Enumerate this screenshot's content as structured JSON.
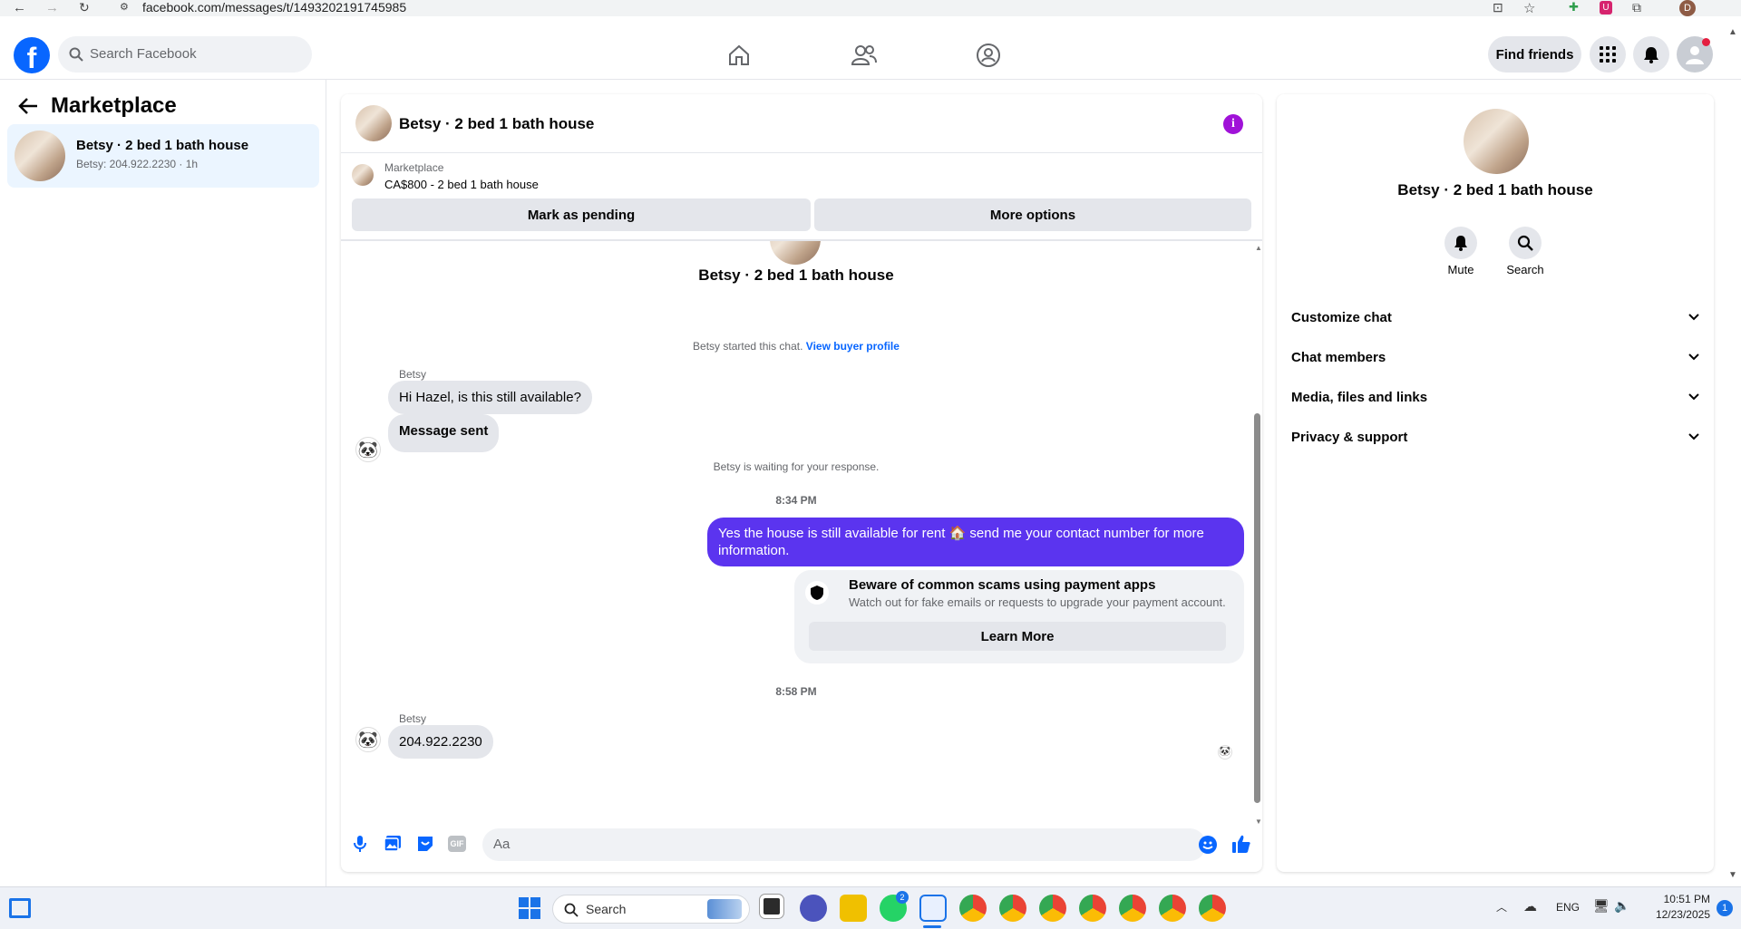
{
  "browser": {
    "url": "facebook.com/messages/t/1493202191745985",
    "avatar_letter": "D"
  },
  "header": {
    "search_placeholder": "Search Facebook",
    "find_friends": "Find friends"
  },
  "sidebar": {
    "title": "Marketplace",
    "conversations": [
      {
        "title": "Betsy · 2 bed 1 bath house",
        "subtitle": "Betsy: 204.922.2230 · 1h"
      }
    ]
  },
  "chat": {
    "title": "Betsy · 2 bed 1 bath house",
    "listing": {
      "label": "Marketplace",
      "price_title": "CA$800 - 2 bed 1 bath house",
      "mark_pending": "Mark as pending",
      "more_options": "More options"
    },
    "profile_name": "Betsy · 2 bed 1 bath house",
    "started_text": "Betsy started this chat.",
    "view_buyer_profile": "View buyer profile",
    "messages_group1": {
      "sender": "Betsy",
      "messages": [
        "Hi Hazel, is this still available?",
        "Message sent"
      ]
    },
    "waiting_text": "Betsy is waiting for your response.",
    "time1": "8:34 PM",
    "outgoing": "Yes the house is still available for rent 🏠 send me your contact number for more information.",
    "scam": {
      "title": "Beware of common scams using payment apps",
      "body": "Watch out for fake emails or requests to upgrade your payment account.",
      "learn_more": "Learn More"
    },
    "time2": "8:58 PM",
    "messages_group2": {
      "sender": "Betsy",
      "messages": [
        "204.922.2230"
      ]
    },
    "composer_placeholder": "Aa",
    "accent": "#5b34ef"
  },
  "details": {
    "name": "Betsy · 2 bed 1 bath house",
    "mute": "Mute",
    "search": "Search",
    "sections": [
      "Customize chat",
      "Chat members",
      "Media, files and links",
      "Privacy & support"
    ]
  },
  "taskbar": {
    "search": "Search",
    "lang": "ENG",
    "time": "10:51 PM",
    "date": "12/23/2025",
    "notifications": "1"
  },
  "colors": {
    "fb_blue": "#0866ff",
    "message_purple": "#5b34ef"
  }
}
